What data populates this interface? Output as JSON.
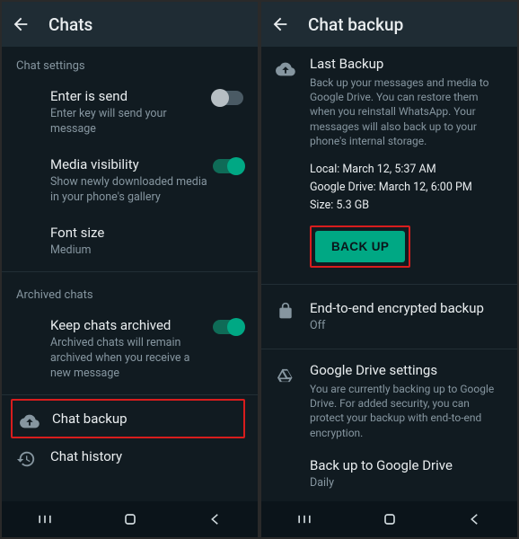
{
  "left": {
    "title": "Chats",
    "section1": "Chat settings",
    "enter": {
      "title": "Enter is send",
      "sub": "Enter key will send your message"
    },
    "media": {
      "title": "Media visibility",
      "sub": "Show newly downloaded media in your phone's gallery"
    },
    "font": {
      "title": "Font size",
      "sub": "Medium"
    },
    "section2": "Archived chats",
    "keep": {
      "title": "Keep chats archived",
      "sub": "Archived chats will remain archived when you receive a new message"
    },
    "backup": {
      "title": "Chat backup"
    },
    "history": {
      "title": "Chat history"
    }
  },
  "right": {
    "title": "Chat backup",
    "last": {
      "title": "Last Backup",
      "desc": "Back up your messages and media to Google Drive. You can restore them when you reinstall WhatsApp. Your messages will also back up to your phone's internal storage.",
      "local": "Local: March 12, 5:37 AM",
      "gdrive": "Google Drive: March 12, 6:00 PM",
      "size": "Size: 5.3 GB",
      "button": "BACK UP"
    },
    "e2e": {
      "title": "End-to-end encrypted backup",
      "sub": "Off"
    },
    "gd": {
      "title": "Google Drive settings",
      "desc": "You are currently backing up to Google Drive. For added security, you can protect your backup with end-to-end encryption.",
      "freq_title": "Back up to Google Drive",
      "freq_value": "Daily"
    }
  }
}
